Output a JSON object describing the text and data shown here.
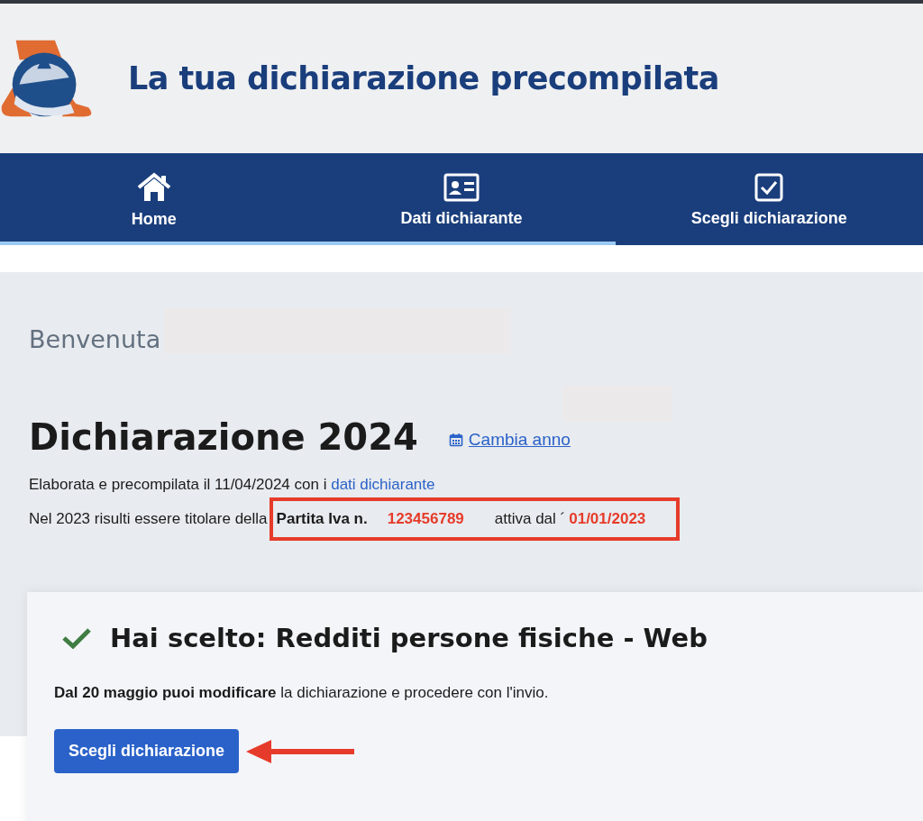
{
  "header": {
    "title": "La tua dichiarazione precompilata"
  },
  "nav": {
    "tabs": [
      {
        "label": "Home",
        "kind": "home",
        "completed": true
      },
      {
        "label": "Dati dichiarante",
        "kind": "card",
        "completed": true
      },
      {
        "label": "Scegli dichiarazione",
        "kind": "check",
        "completed": false
      }
    ]
  },
  "welcome": "Benvenuta",
  "declaration": {
    "title": "Dichiarazione 2024",
    "change_year_link": "Cambia anno",
    "processed_text": "Elaborata e precompilata il 11/04/2024 con i",
    "processed_link": "dati dichiarante",
    "vat_intro": "Nel 2023 risulti essere titolare della",
    "vat_label": "Partita Iva n.",
    "vat_number": "123456789",
    "active_label": "attiva dal ´",
    "active_date": "01/01/2023",
    "highlighted": true
  },
  "choice": {
    "title": "Hai scelto: Redditi persone fisiche - Web",
    "text": "**Dal 20 maggio puoi modificare** la dichiarazione e procedere con l'invio.",
    "button": "Scegli dichiarazione",
    "arrow": true
  }
}
